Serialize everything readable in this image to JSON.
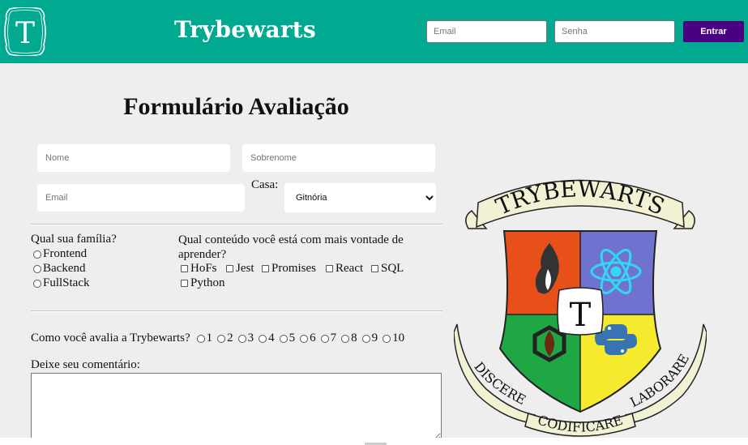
{
  "header": {
    "logo_letter": "T",
    "title": "Trybewarts",
    "email_placeholder": "Email",
    "password_placeholder": "Senha",
    "login_button": "Entrar",
    "bg_color": "#00a98f",
    "button_color": "#4b0082"
  },
  "form": {
    "title": "Formulário Avaliação",
    "name_placeholder": "Nome",
    "lastname_placeholder": "Sobrenome",
    "email_placeholder": "Email",
    "house_label": "Casa:",
    "house_selected": "Gitnória",
    "family": {
      "question": "Qual sua família?",
      "options": [
        "Frontend",
        "Backend",
        "FullStack"
      ]
    },
    "subjects": {
      "question": "Qual conteúdo você está com mais vontade de aprender?",
      "options": [
        "HoFs",
        "Jest",
        "Promises",
        "React",
        "SQL",
        "Python"
      ]
    },
    "rating": {
      "question": "Como você avalia a Trybewarts?",
      "options": [
        "1",
        "2",
        "3",
        "4",
        "5",
        "6",
        "7",
        "8",
        "9",
        "10"
      ]
    },
    "comment_label": "Deixe seu comentário:"
  },
  "crest": {
    "top_banner": "TRYBEWARTS",
    "left_ribbon": "DISCERE",
    "bottom_ribbon": "CODIFICARE",
    "right_ribbon": "LABORARE",
    "center_letter": "T",
    "quadrant_colors": [
      "#e8501a",
      "#6f73cf",
      "#1fa645",
      "#f5ea2e"
    ]
  }
}
